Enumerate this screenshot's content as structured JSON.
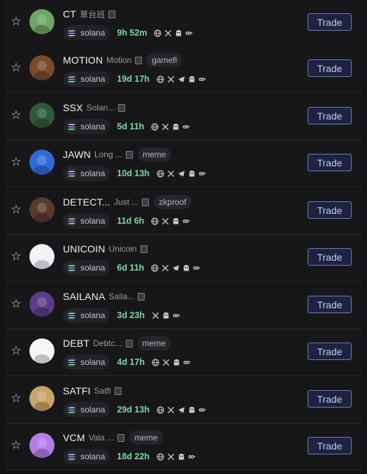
{
  "chain_label": "solana",
  "trade_label": "Trade",
  "colors": {
    "background": "#131316",
    "age_text": "#7fd4a0",
    "trade_border": "#6d7cb8",
    "trade_text": "#c3ccf3"
  },
  "tokens": [
    {
      "ticker": "CT",
      "name": "草台班",
      "tag": "",
      "age": "9h 52m",
      "links": [
        "globe-icon",
        "x-icon",
        "ghost-icon",
        "dex-icon"
      ],
      "avatar_color": "#6fa46a"
    },
    {
      "ticker": "MOTION",
      "name": "Motion",
      "tag": "gamefi",
      "age": "19d 17h",
      "links": [
        "globe-icon",
        "x-icon",
        "telegram-icon",
        "ghost-icon",
        "dex-icon"
      ],
      "avatar_color": "#7a4a2a"
    },
    {
      "ticker": "SSX",
      "name": "Solan...",
      "tag": "",
      "age": "5d 11h",
      "links": [
        "globe-icon",
        "x-icon",
        "ghost-icon",
        "dex-icon"
      ],
      "avatar_color": "#2f5a3a"
    },
    {
      "ticker": "JAWN",
      "name": "Long ...",
      "tag": "meme",
      "age": "10d 13h",
      "links": [
        "globe-icon",
        "x-icon",
        "telegram-icon",
        "ghost-icon",
        "dex-icon"
      ],
      "avatar_color": "#2f6bd6"
    },
    {
      "ticker": "DETECT...",
      "name": "Just ...",
      "tag": "zkproof",
      "age": "11d 6h",
      "links": [
        "globe-icon",
        "x-icon",
        "ghost-icon",
        "dex-icon"
      ],
      "avatar_color": "#5a3a30"
    },
    {
      "ticker": "UNICOIN",
      "name": "Unicoin",
      "tag": "",
      "age": "6d 11h",
      "links": [
        "globe-icon",
        "x-icon",
        "telegram-icon",
        "ghost-icon",
        "dex-icon"
      ],
      "avatar_color": "#f4f2f8"
    },
    {
      "ticker": "SAILANA",
      "name": "Saila...",
      "tag": "",
      "age": "3d 23h",
      "links": [
        "x-icon",
        "ghost-icon",
        "dex-icon"
      ],
      "avatar_color": "#5a3c8a"
    },
    {
      "ticker": "DEBT",
      "name": "Debtc...",
      "tag": "meme",
      "age": "4d 17h",
      "links": [
        "globe-icon",
        "x-icon",
        "ghost-icon",
        "dex-icon"
      ],
      "avatar_color": "#f5f5f5"
    },
    {
      "ticker": "SATFI",
      "name": "Satfi",
      "tag": "",
      "age": "29d 13h",
      "links": [
        "globe-icon",
        "x-icon",
        "telegram-icon",
        "ghost-icon",
        "dex-icon"
      ],
      "avatar_color": "#c9a46a"
    },
    {
      "ticker": "VCM",
      "name": "Vala ...",
      "tag": "meme",
      "age": "18d 22h",
      "links": [
        "globe-icon",
        "x-icon",
        "ghost-icon",
        "dex-icon"
      ],
      "avatar_color": "#b67be8"
    }
  ]
}
